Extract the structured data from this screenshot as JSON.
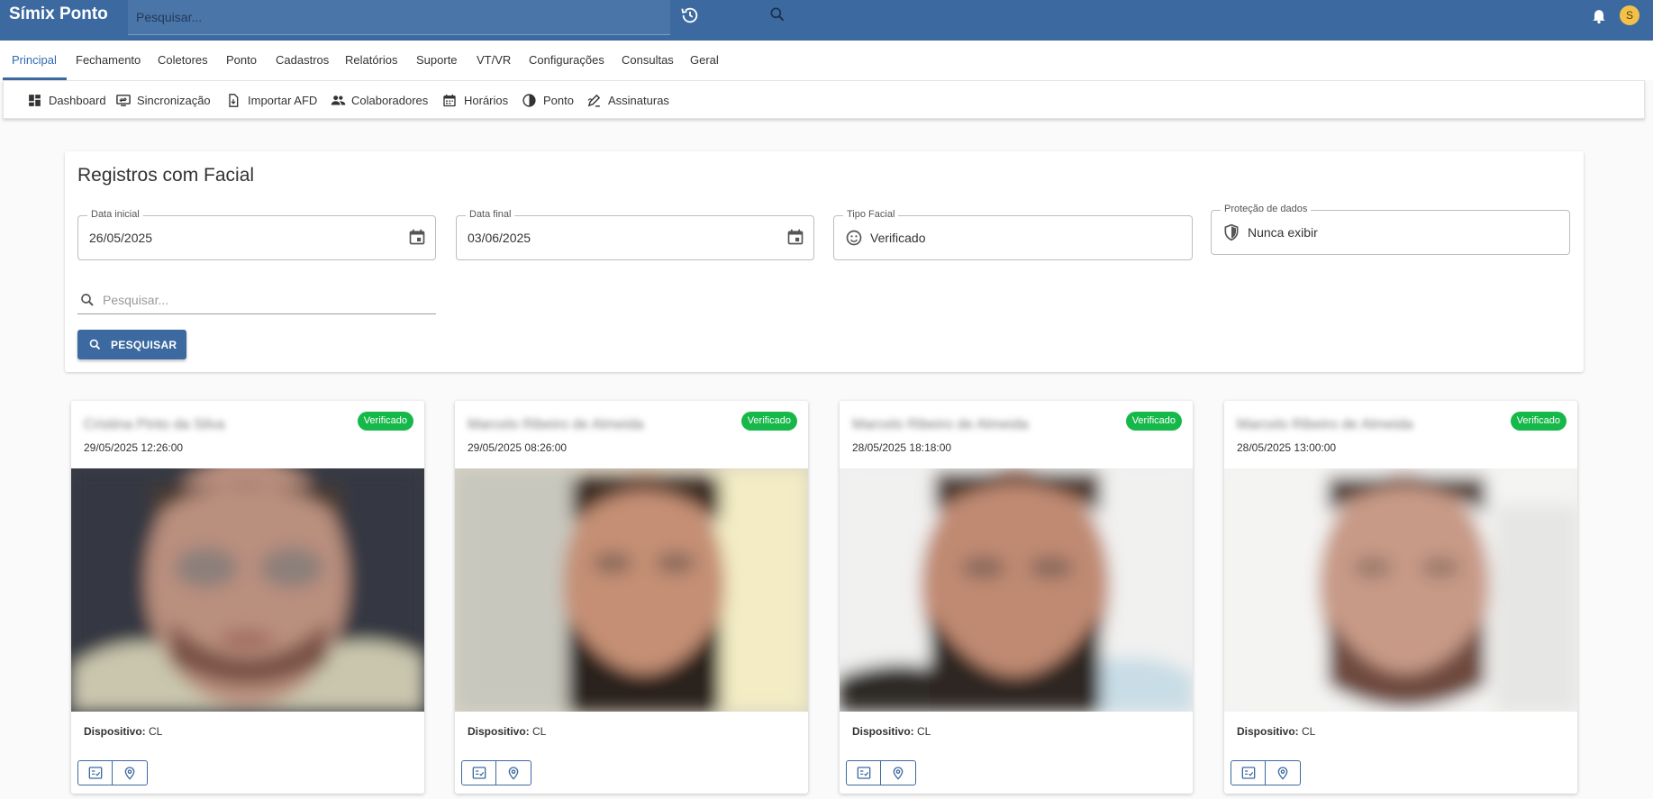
{
  "app": {
    "title": "Símix Ponto",
    "search_placeholder": "Pesquisar...",
    "avatar_initial": "S"
  },
  "tabs": [
    {
      "label": "Principal",
      "active": true
    },
    {
      "label": "Fechamento"
    },
    {
      "label": "Coletores"
    },
    {
      "label": "Ponto"
    },
    {
      "label": "Cadastros"
    },
    {
      "label": "Relatórios"
    },
    {
      "label": "Suporte"
    },
    {
      "label": "VT/VR"
    },
    {
      "label": "Configurações"
    },
    {
      "label": "Consultas"
    },
    {
      "label": "Geral"
    }
  ],
  "toolbar": [
    {
      "label": "Dashboard",
      "icon": "dashboard-icon"
    },
    {
      "label": "Sincronização",
      "icon": "sync-icon"
    },
    {
      "label": "Importar AFD",
      "icon": "import-file-icon"
    },
    {
      "label": "Colaboradores",
      "icon": "people-icon"
    },
    {
      "label": "Horários",
      "icon": "calendar-icon"
    },
    {
      "label": "Ponto",
      "icon": "clock-icon"
    },
    {
      "label": "Assinaturas",
      "icon": "signature-icon"
    }
  ],
  "filters": {
    "title": "Registros com Facial",
    "start_date": {
      "label": "Data inicial",
      "value": "26/05/2025"
    },
    "end_date": {
      "label": "Data final",
      "value": "03/06/2025"
    },
    "face_type": {
      "label": "Tipo Facial",
      "value": "Verificado"
    },
    "data_protection": {
      "label": "Proteção de dados",
      "value": "Nunca exibir"
    },
    "search_placeholder": "Pesquisar...",
    "search_button": "PESQUISAR"
  },
  "records": [
    {
      "name": "Cristina Pinto da Silva",
      "status": "Verificado",
      "datetime": "29/05/2025 12:26:00",
      "device_label": "Dispositivo:",
      "device": "CL"
    },
    {
      "name": "Marcelo Ribeiro de Almeida",
      "status": "Verificado",
      "datetime": "29/05/2025 08:26:00",
      "device_label": "Dispositivo:",
      "device": "CL"
    },
    {
      "name": "Marcelo Ribeiro de Almeida",
      "status": "Verificado",
      "datetime": "28/05/2025 18:18:00",
      "device_label": "Dispositivo:",
      "device": "CL"
    },
    {
      "name": "Marcelo Ribeiro de Almeida",
      "status": "Verificado",
      "datetime": "28/05/2025 13:00:00",
      "device_label": "Dispositivo:",
      "device": "CL"
    }
  ],
  "colors": {
    "primary": "#3c6aa0",
    "badge": "#16b84a",
    "avatar": "#f3c14a"
  }
}
